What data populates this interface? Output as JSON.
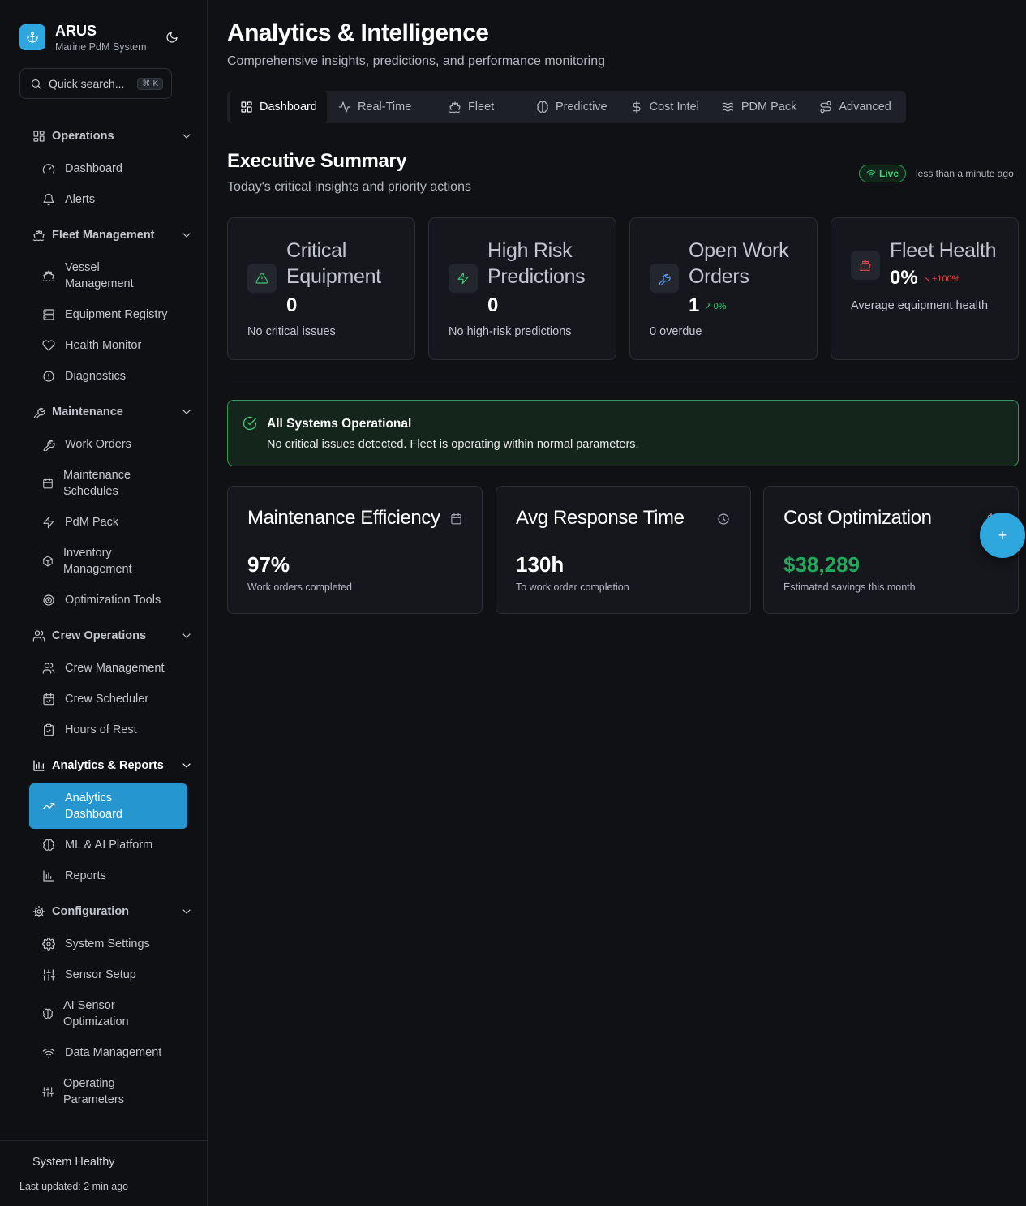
{
  "brand": {
    "name": "ARUS",
    "subtitle": "Marine PdM System"
  },
  "search": {
    "placeholder": "Quick search...",
    "shortcut": "⌘ K"
  },
  "sidebar": {
    "groups": [
      {
        "label": "Operations",
        "icon": "grid-icon",
        "items": [
          {
            "label": "Dashboard",
            "icon": "gauge-icon"
          },
          {
            "label": "Alerts",
            "icon": "bell-icon"
          }
        ]
      },
      {
        "label": "Fleet Management",
        "icon": "ship-icon",
        "items": [
          {
            "label": "Vessel Management",
            "icon": "ship-icon"
          },
          {
            "label": "Equipment Registry",
            "icon": "server-icon"
          },
          {
            "label": "Health Monitor",
            "icon": "heart-icon"
          },
          {
            "label": "Diagnostics",
            "icon": "alert-circle-icon"
          }
        ]
      },
      {
        "label": "Maintenance",
        "icon": "wrench-icon",
        "items": [
          {
            "label": "Work Orders",
            "icon": "wrench-icon"
          },
          {
            "label": "Maintenance Schedules",
            "icon": "calendar-icon"
          },
          {
            "label": "PdM Pack",
            "icon": "zap-icon"
          },
          {
            "label": "Inventory Management",
            "icon": "package-icon"
          },
          {
            "label": "Optimization Tools",
            "icon": "target-icon"
          }
        ]
      },
      {
        "label": "Crew Operations",
        "icon": "users-icon",
        "items": [
          {
            "label": "Crew Management",
            "icon": "users-icon"
          },
          {
            "label": "Crew Scheduler",
            "icon": "calendar-check-icon"
          },
          {
            "label": "Hours of Rest",
            "icon": "clipboard-check-icon"
          }
        ]
      },
      {
        "label": "Analytics & Reports",
        "icon": "bar-chart-icon",
        "items": [
          {
            "label": "Analytics Dashboard",
            "icon": "trending-up-icon",
            "active": true
          },
          {
            "label": "ML & AI Platform",
            "icon": "brain-icon"
          },
          {
            "label": "Reports",
            "icon": "bar-chart-icon"
          }
        ]
      },
      {
        "label": "Configuration",
        "icon": "cog-icon",
        "items": [
          {
            "label": "System Settings",
            "icon": "settings-icon"
          },
          {
            "label": "Sensor Setup",
            "icon": "sliders-icon"
          },
          {
            "label": "AI Sensor Optimization",
            "icon": "brain-icon"
          },
          {
            "label": "Data Management",
            "icon": "wifi-icon"
          },
          {
            "label": "Operating Parameters",
            "icon": "sliders-icon"
          }
        ]
      }
    ],
    "footer": {
      "status": "System Healthy",
      "updated": "Last updated: 2 min ago"
    }
  },
  "page": {
    "title": "Analytics & Intelligence",
    "subtitle": "Comprehensive insights, predictions, and performance monitoring"
  },
  "tabs": [
    {
      "label": "Dashboard",
      "icon": "grid-icon",
      "active": true
    },
    {
      "label": "Real-Time",
      "icon": "activity-icon"
    },
    {
      "label": "Fleet",
      "icon": "ship-icon"
    },
    {
      "label": "Predictive",
      "icon": "brain-icon"
    },
    {
      "label": "Cost Intel",
      "icon": "dollar-icon"
    },
    {
      "label": "PDM Pack",
      "icon": "waves-icon"
    },
    {
      "label": "Advanced",
      "icon": "route-icon"
    }
  ],
  "summary": {
    "title": "Executive Summary",
    "subtitle": "Today's critical insights and priority actions",
    "live": "Live",
    "updated": "less than a minute ago"
  },
  "kpis": [
    {
      "title_l1": "Critical",
      "title_l2": "Equipment",
      "value": "0",
      "desc": "No critical issues",
      "icon": "alert-triangle-icon",
      "color": "#3fc774"
    },
    {
      "title_l1": "High Risk",
      "title_l2": "Predictions",
      "value": "0",
      "desc": "No high-risk predictions",
      "icon": "zap-icon",
      "color": "#3fc774"
    },
    {
      "title_l1": "Open Work",
      "title_l2": "Orders",
      "value": "1",
      "trend": "0%",
      "trend_color": "#3fc774",
      "desc": "0 overdue",
      "icon": "wrench-icon",
      "color": "#5b9cf0"
    },
    {
      "title_l1": "Fleet Health",
      "value": "0%",
      "trend": "+100%",
      "trend_color": "#e5484d",
      "desc": "Average equipment health",
      "icon": "ship-icon",
      "color": "#e5484d"
    }
  ],
  "alert": {
    "title": "All Systems Operational",
    "desc": "No critical issues detected. Fleet is operating within normal parameters."
  },
  "metrics": [
    {
      "title": "Maintenance Efficiency",
      "value": "97%",
      "desc": "Work orders completed",
      "icon": "calendar-icon",
      "value_color": "#ffffff"
    },
    {
      "title": "Avg Response Time",
      "value": "130h",
      "desc": "To work order completion",
      "icon": "clock-icon",
      "value_color": "#ffffff"
    },
    {
      "title": "Cost Optimization",
      "value": "$38,289",
      "desc": "Estimated savings this month",
      "icon": "dollar-icon",
      "value_color": "#22a85a"
    }
  ],
  "fab": {
    "label": "+"
  }
}
